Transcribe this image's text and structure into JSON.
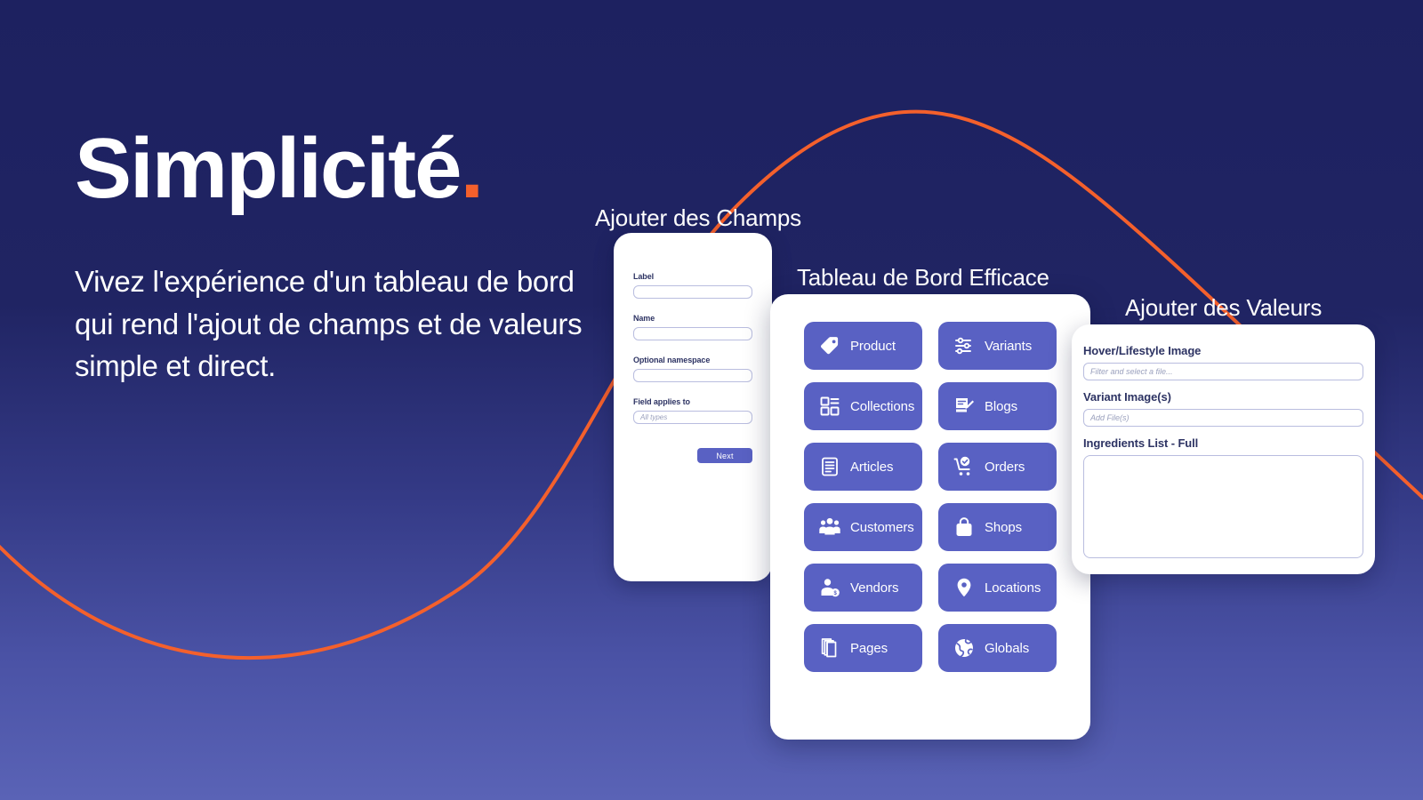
{
  "hero": {
    "title": "Simplicité",
    "title_dot": ".",
    "subtitle": "Vivez l'expérience d'un tableau de bord qui rend l'ajout de champs et de valeurs simple et direct."
  },
  "colors": {
    "background_top": "#1d2160",
    "background_bottom": "#5a63b6",
    "accent_orange": "#F4602C",
    "tile_indigo": "#5961c3",
    "label_navy": "#2d3363",
    "field_border": "#b9bddf"
  },
  "fields_card": {
    "title": "Ajouter des Champs",
    "fields": [
      {
        "label": "Label",
        "value": "",
        "placeholder": ""
      },
      {
        "label": "Name",
        "value": "",
        "placeholder": ""
      },
      {
        "label": "Optional namespace",
        "value": "",
        "placeholder": ""
      },
      {
        "label": "Field applies to",
        "value": "",
        "placeholder": "All types"
      }
    ],
    "next_label": "Next"
  },
  "dashboard_card": {
    "title": "Tableau de Bord Efficace",
    "tiles": [
      {
        "label": "Product",
        "icon": "tag-icon"
      },
      {
        "label": "Variants",
        "icon": "sliders-icon"
      },
      {
        "label": "Collections",
        "icon": "grid-icon"
      },
      {
        "label": "Blogs",
        "icon": "document-pencil-icon"
      },
      {
        "label": "Articles",
        "icon": "document-lines-icon"
      },
      {
        "label": "Orders",
        "icon": "shopping-cart-icon"
      },
      {
        "label": "Customers",
        "icon": "people-icon"
      },
      {
        "label": "Shops",
        "icon": "shopping-bag-icon"
      },
      {
        "label": "Vendors",
        "icon": "person-badge-icon"
      },
      {
        "label": "Locations",
        "icon": "map-pin-icon"
      },
      {
        "label": "Pages",
        "icon": "pages-stack-icon"
      },
      {
        "label": "Globals",
        "icon": "globe-icon"
      }
    ]
  },
  "values_card": {
    "title": "Ajouter des Valeurs",
    "fields": [
      {
        "label": "Hover/Lifestyle Image",
        "value": "",
        "placeholder": "Filter and select a file..."
      },
      {
        "label": "Variant Image(s)",
        "value": "",
        "placeholder": "Add File(s)"
      }
    ],
    "textarea": {
      "label": "Ingredients List - Full",
      "value": ""
    }
  }
}
